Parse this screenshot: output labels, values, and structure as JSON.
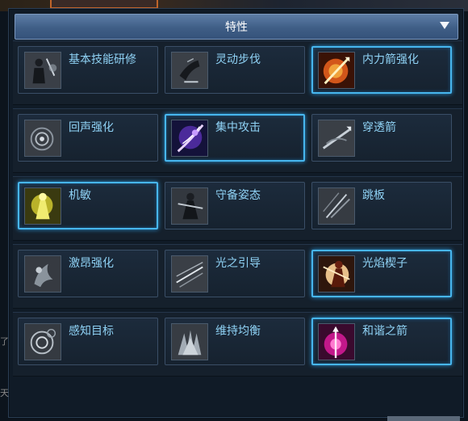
{
  "panel": {
    "title": "特性",
    "dropdown_icon": "chevron-down-icon"
  },
  "edge_texts": [
    "了",
    "天"
  ],
  "colors": {
    "selected_border": "#47b6ee",
    "label_text": "#8fd2f5",
    "header_bg": "#4a6a92"
  },
  "rows": [
    {
      "traits": [
        {
          "label": "基本技能研修",
          "icon": "basic-skill-icon",
          "selected": false
        },
        {
          "label": "灵动步伐",
          "icon": "agile-step-icon",
          "selected": false
        },
        {
          "label": "内力箭强化",
          "icon": "inner-arrow-icon",
          "selected": true
        }
      ]
    },
    {
      "traits": [
        {
          "label": "回声强化",
          "icon": "echo-icon",
          "selected": false
        },
        {
          "label": "集中攻击",
          "icon": "focus-attack-icon",
          "selected": true
        },
        {
          "label": "穿透箭",
          "icon": "pierce-arrow-icon",
          "selected": false
        }
      ]
    },
    {
      "traits": [
        {
          "label": "机敏",
          "icon": "alert-icon",
          "selected": true
        },
        {
          "label": "守备姿态",
          "icon": "guard-stance-icon",
          "selected": false
        },
        {
          "label": "跳板",
          "icon": "springboard-icon",
          "selected": false
        }
      ]
    },
    {
      "traits": [
        {
          "label": "激昂强化",
          "icon": "excite-icon",
          "selected": false
        },
        {
          "label": "光之引导",
          "icon": "light-guide-icon",
          "selected": false
        },
        {
          "label": "光焰楔子",
          "icon": "flame-wedge-icon",
          "selected": true
        }
      ]
    },
    {
      "traits": [
        {
          "label": "感知目标",
          "icon": "sense-target-icon",
          "selected": false
        },
        {
          "label": "维持均衡",
          "icon": "balance-icon",
          "selected": false
        },
        {
          "label": "和谐之箭",
          "icon": "harmony-arrow-icon",
          "selected": true
        }
      ]
    }
  ]
}
